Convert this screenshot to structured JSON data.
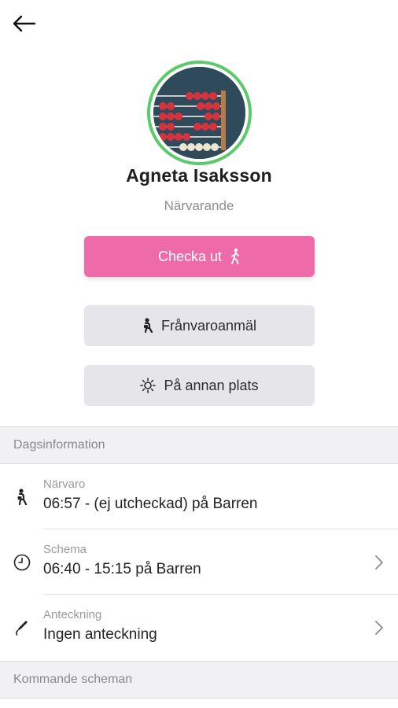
{
  "profile": {
    "name": "Agneta Isaksson",
    "status": "Närvarande"
  },
  "actions": {
    "checkout_label": "Checka ut",
    "absence_label": "Frånvaroanmäl",
    "other_place_label": "På annan plats"
  },
  "day_info": {
    "header": "Dagsinformation",
    "rows": [
      {
        "label": "Närvaro",
        "value": "06:57 - (ej utcheckad) på Barren",
        "icon": "presence-figure-icon"
      },
      {
        "label": "Schema",
        "value": "06:40 - 15:15 på Barren",
        "icon": "clock-icon"
      },
      {
        "label": "Anteckning",
        "value": "Ingen anteckning",
        "icon": "pen-icon"
      }
    ]
  },
  "upcoming": {
    "header": "Kommande scheman"
  },
  "colors": {
    "accent_pink": "#ee6aa9",
    "avatar_ring": "#5cc96a",
    "secondary_button": "#e6e6ea"
  }
}
